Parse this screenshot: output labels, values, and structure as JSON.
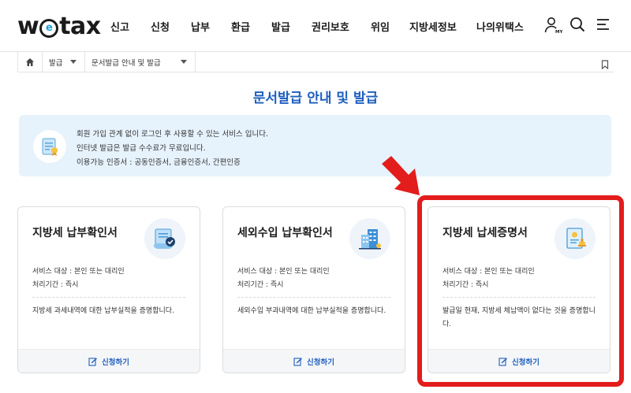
{
  "header": {
    "logo_text_1": "w",
    "logo_mark": "e",
    "logo_text_2": "tax",
    "nav": [
      "신고",
      "신청",
      "납부",
      "환급",
      "발급",
      "권리보호",
      "위임",
      "지방세정보",
      "나의위택스"
    ],
    "icons": [
      "my-page-icon",
      "search-icon",
      "menu-icon"
    ],
    "my_badge": "MY"
  },
  "breadcrumb": {
    "items": [
      "발급",
      "문서발급 안내 및 발급"
    ],
    "icons": [
      "home-icon",
      "bookmark-icon"
    ]
  },
  "page_title": "문서발급 안내 및 발급",
  "info": {
    "lines": [
      "회원 가입 관계 없이 로그인 후 사용할 수 있는 서비스 입니다.",
      "인터넷 발급은 발급 수수료가 무료입니다.",
      "이용가능 인증서 : 공동인증서, 금융인증서, 간편인증"
    ],
    "icon": "certificate-scroll-icon"
  },
  "cards": [
    {
      "title": "지방세 납부확인서",
      "target": "서비스 대상 : 본인 또는 대리인",
      "period": "처리기간 : 즉시",
      "desc": "지방세 과세내역에 대한 납부실적을 증명합니다.",
      "apply": "신청하기",
      "icon": "paper-check-icon"
    },
    {
      "title": "세외수입 납부확인서",
      "target": "서비스 대상 : 본인 또는 대리인",
      "period": "처리기간 : 즉시",
      "desc": "세외수입 부과내역에 대한 납부실적을 증명합니다.",
      "apply": "신청하기",
      "icon": "building-icon"
    },
    {
      "title": "지방세 납세증명서",
      "target": "서비스 대상 : 본인 또는 대리인",
      "period": "처리기간 : 즉시",
      "desc": "발급일 현재, 지방세 체납액이 없다는 것을 증명합니다.",
      "apply": "신청하기",
      "icon": "certificate-stamp-icon"
    }
  ],
  "colors": {
    "brand_blue": "#1e5fbf",
    "info_bg": "#e6f2fc",
    "highlight_red": "#e31c1c"
  }
}
